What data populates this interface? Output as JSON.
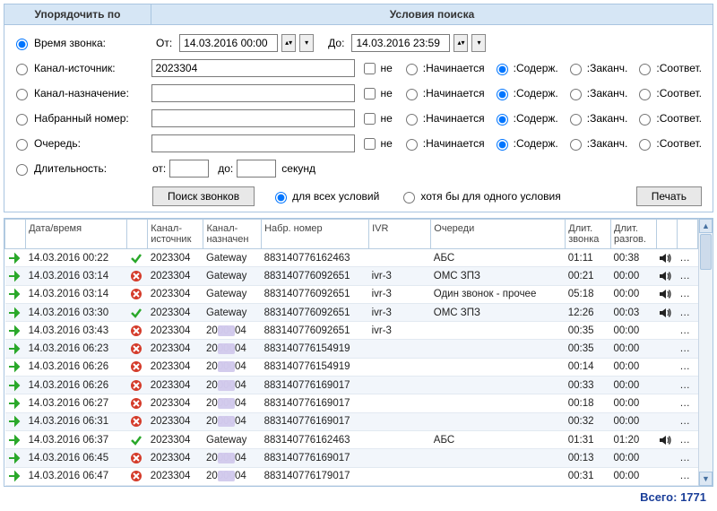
{
  "headers": {
    "sort": "Упорядочить по",
    "criteria": "Условия поиска"
  },
  "sort_options": {
    "time": "Время звонка:",
    "src": "Канал-источник:",
    "dst": "Канал-назначение:",
    "dialed": "Набранный номер:",
    "queue": "Очередь:",
    "duration": "Длительность:"
  },
  "date": {
    "from_lbl": "От:",
    "from_val": "14.03.2016 00:00",
    "to_lbl": "До:",
    "to_val": "14.03.2016 23:59"
  },
  "filter_rows": {
    "src_val": "2023304",
    "dst_val": "",
    "dialed_val": "",
    "queue_val": ""
  },
  "not_label": "не",
  "match": {
    "starts": ":Начинается",
    "contains": ":Содерж.",
    "ends": ":Заканч.",
    "equals": ":Соответ."
  },
  "duration": {
    "from": "от:",
    "to": "до:",
    "sec": "секунд",
    "from_val": "",
    "to_val": ""
  },
  "buttons": {
    "search": "Поиск звонков",
    "print": "Печать"
  },
  "combine": {
    "all": "для всех условий",
    "any": "хотя бы для одного условия"
  },
  "columns": {
    "dir": "",
    "datetime": "Дата/время",
    "status": "",
    "src": "Канал-источник",
    "dst": "Канал-назначен",
    "dialed": "Набр. номер",
    "ivr": "IVR",
    "queues": "Очереди",
    "dur_call": "Длит. звонка",
    "dur_talk": "Длит. разгов.",
    "snd": "",
    "more": ""
  },
  "rows": [
    {
      "dt": "14.03.2016 00:22",
      "ok": true,
      "src": "2023304",
      "dst": "Gateway",
      "dst_blur": false,
      "num": "883140776162463",
      "ivr": "",
      "q": "АБС",
      "d1": "01:11",
      "d2": "00:38",
      "snd": true
    },
    {
      "dt": "14.03.2016 03:14",
      "ok": false,
      "src": "2023304",
      "dst": "Gateway",
      "dst_blur": false,
      "num": "883140776092651",
      "ivr": "ivr-3",
      "q": "ОМС ЗПЗ",
      "d1": "00:21",
      "d2": "00:00",
      "snd": true
    },
    {
      "dt": "14.03.2016 03:14",
      "ok": false,
      "src": "2023304",
      "dst": "Gateway",
      "dst_blur": false,
      "num": "883140776092651",
      "ivr": "ivr-3",
      "q": "Один звонок - прочее",
      "d1": "05:18",
      "d2": "00:00",
      "snd": true
    },
    {
      "dt": "14.03.2016 03:30",
      "ok": true,
      "src": "2023304",
      "dst": "Gateway",
      "dst_blur": false,
      "num": "883140776092651",
      "ivr": "ivr-3",
      "q": "ОМС ЗПЗ",
      "d1": "12:26",
      "d2": "00:03",
      "snd": true
    },
    {
      "dt": "14.03.2016 03:43",
      "ok": false,
      "src": "2023304",
      "dst": "2000004",
      "dst_blur": true,
      "num": "883140776092651",
      "ivr": "ivr-3",
      "q": "",
      "d1": "00:35",
      "d2": "00:00",
      "snd": false
    },
    {
      "dt": "14.03.2016 06:23",
      "ok": false,
      "src": "2023304",
      "dst": "2000004",
      "dst_blur": true,
      "num": "883140776154919",
      "ivr": "",
      "q": "",
      "d1": "00:35",
      "d2": "00:00",
      "snd": false
    },
    {
      "dt": "14.03.2016 06:26",
      "ok": false,
      "src": "2023304",
      "dst": "2000004",
      "dst_blur": true,
      "num": "883140776154919",
      "ivr": "",
      "q": "",
      "d1": "00:14",
      "d2": "00:00",
      "snd": false
    },
    {
      "dt": "14.03.2016 06:26",
      "ok": false,
      "src": "2023304",
      "dst": "2000004",
      "dst_blur": true,
      "num": "883140776169017",
      "ivr": "",
      "q": "",
      "d1": "00:33",
      "d2": "00:00",
      "snd": false
    },
    {
      "dt": "14.03.2016 06:27",
      "ok": false,
      "src": "2023304",
      "dst": "2000004",
      "dst_blur": true,
      "num": "883140776169017",
      "ivr": "",
      "q": "",
      "d1": "00:18",
      "d2": "00:00",
      "snd": false
    },
    {
      "dt": "14.03.2016 06:31",
      "ok": false,
      "src": "2023304",
      "dst": "2000004",
      "dst_blur": true,
      "num": "883140776169017",
      "ivr": "",
      "q": "",
      "d1": "00:32",
      "d2": "00:00",
      "snd": false
    },
    {
      "dt": "14.03.2016 06:37",
      "ok": true,
      "src": "2023304",
      "dst": "Gateway",
      "dst_blur": false,
      "num": "883140776162463",
      "ivr": "",
      "q": "АБС",
      "d1": "01:31",
      "d2": "01:20",
      "snd": true
    },
    {
      "dt": "14.03.2016 06:45",
      "ok": false,
      "src": "2023304",
      "dst": "2000004",
      "dst_blur": true,
      "num": "883140776169017",
      "ivr": "",
      "q": "",
      "d1": "00:13",
      "d2": "00:00",
      "snd": false
    },
    {
      "dt": "14.03.2016 06:47",
      "ok": false,
      "src": "2023304",
      "dst": "2000004",
      "dst_blur": true,
      "num": "883140776179017",
      "ivr": "",
      "q": "",
      "d1": "00:31",
      "d2": "00:00",
      "snd": false
    }
  ],
  "total": {
    "label": "Всего:",
    "value": "1771"
  }
}
